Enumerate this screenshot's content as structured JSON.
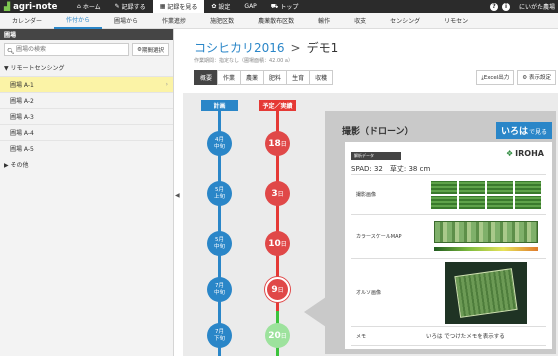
{
  "app": {
    "brand": "agri-note",
    "topnav": [
      {
        "icon": "home-icon",
        "glyph": "⌂",
        "label": "ホーム"
      },
      {
        "icon": "pen-icon",
        "glyph": "✎",
        "label": "記録する"
      },
      {
        "icon": "list-icon",
        "glyph": "▦",
        "label": "記録を見る",
        "active": true
      },
      {
        "icon": "gear-icon",
        "glyph": "✿",
        "label": "設定"
      },
      {
        "icon": "",
        "glyph": "",
        "label": "GAP"
      },
      {
        "icon": "truck-icon",
        "glyph": "⛟",
        "label": "トップ"
      }
    ],
    "help": "?",
    "info": "i",
    "user": "にいがた農場"
  },
  "subnav": [
    "カレンダー",
    "作付から",
    "圃場から",
    "作業進捗",
    "施肥区数",
    "農薬散布区数",
    "輸作",
    "収支",
    "センシング",
    "リモセン"
  ],
  "subnav_active": "作付から",
  "sidebar": {
    "header": "圃場",
    "search_placeholder": "圃場の検索",
    "period_button": "期間選択",
    "group1": "▼ リモートセンシング",
    "fields": [
      "圃場 A-1",
      "圃場 A-2",
      "圃場 A-3",
      "圃場 A-4",
      "圃場 A-5"
    ],
    "active_field": "圃場 A-1",
    "group2": "▶ その他"
  },
  "main": {
    "field_title": "コシヒカリ2016",
    "crumb_sep": ">",
    "sub_title": "デモ1",
    "area_info": "作業期間：指定なし（圃場面積：42.00 a）",
    "tabs": [
      "概要",
      "作業",
      "農薬",
      "肥料",
      "生育",
      "収穫"
    ],
    "active_tab": "概要",
    "excel_button": "Excel出力",
    "display_button": "表示設定"
  },
  "timeline": {
    "plan_header": "計画",
    "actual_header": "予定／実績",
    "plan_nodes": [
      {
        "m": "4月",
        "p": "中旬"
      },
      {
        "m": "5月",
        "p": "上旬"
      },
      {
        "m": "5月",
        "p": "中旬"
      },
      {
        "m": "7月",
        "p": "中旬"
      },
      {
        "m": "7月",
        "p": "下旬"
      }
    ],
    "actual_nodes": [
      {
        "n": "18",
        "d": "日",
        "state": "red"
      },
      {
        "n": "3",
        "d": "日",
        "state": "red"
      },
      {
        "n": "10",
        "d": "日",
        "state": "red"
      },
      {
        "n": "9",
        "d": "日",
        "state": "red-highlight"
      },
      {
        "n": "20",
        "d": "日",
        "state": "green"
      }
    ]
  },
  "panel": {
    "title": "撮影（ドローン）",
    "button_main": "いろは",
    "button_sub": "で見る",
    "card_tag": "解析データ",
    "logo": "IROHA",
    "metric": "SPAD: 32　草丈: 38 cm",
    "rows": [
      "撮影画像",
      "カラースケールMAP",
      "オルソ画像",
      "メモ"
    ],
    "memo_text": "いろは でつけたメモを表示する"
  },
  "colors": {
    "accent": "#2a86c8",
    "red": "#e04848",
    "green": "#9de29d",
    "highlight": "#fbf3a6"
  }
}
